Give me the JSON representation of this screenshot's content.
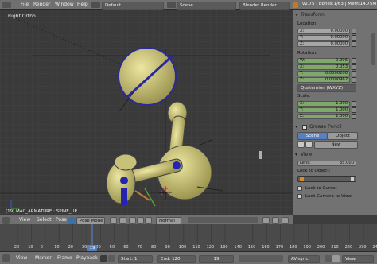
{
  "top_menu": {
    "file": "File",
    "render": "Render",
    "window": "Window",
    "help": "Help",
    "layout": "Default",
    "scene": "Scene",
    "engine": "Blender Render",
    "stats": "v2.75 | Bones:1/63 | Mem:14.75M"
  },
  "viewport": {
    "view_label": "Right Ortho",
    "status_label": "(19) MAC_ARMATURE : SPINE_UP"
  },
  "view3d_header": {
    "view": "View",
    "select": "Select",
    "pose": "Pose",
    "mode": "Pose Mode",
    "pivot": "Normal"
  },
  "npanel": {
    "transform": {
      "title": "Transform",
      "location_label": "Location:",
      "loc": [
        {
          "k": "X:",
          "v": "0.00000"
        },
        {
          "k": "Y:",
          "v": "0.00000"
        },
        {
          "k": "Z:",
          "v": "0.00000"
        }
      ],
      "rotation_label": "Rotation:",
      "rot": [
        {
          "k": "W:",
          "v": "0.996"
        },
        {
          "k": "X:",
          "v": "0.053"
        },
        {
          "k": "Y:",
          "v": "0.0000208"
        },
        {
          "k": "Z:",
          "v": "0.0000962"
        }
      ],
      "rotation_mode": "Quaternion (WXYZ)",
      "scale_label": "Scale:",
      "scale": [
        {
          "k": "X:",
          "v": "1.000"
        },
        {
          "k": "Y:",
          "v": "1.000"
        },
        {
          "k": "Z:",
          "v": "1.000"
        }
      ]
    },
    "grease": {
      "title": "Grease Pencil",
      "scene_tab": "Scene",
      "object_tab": "Object",
      "new_button": "New"
    },
    "view": {
      "title": "View",
      "lens_k": "Lens:",
      "lens_v": "35.000",
      "lock_label": "Lock to Object:",
      "lock_cursor": "Lock to Cursor",
      "lock_camera": "Lock Camera to View"
    }
  },
  "timeline": {
    "ticks": [
      "-20",
      "-10",
      "0",
      "10",
      "20",
      "30",
      "40",
      "50",
      "60",
      "70",
      "80",
      "90",
      "100",
      "110",
      "120",
      "130",
      "140",
      "150",
      "160",
      "170",
      "180",
      "190",
      "200",
      "210",
      "220",
      "230",
      "240"
    ],
    "cursor_frame": "19"
  },
  "timeline_header": {
    "view": "View",
    "marker": "Marker",
    "frame": "Frame",
    "playback": "Playback",
    "start_k": "Start:",
    "start_v": "1",
    "end_k": "End:",
    "end_v": "120",
    "current": "19",
    "sync": "AV-sync",
    "view_btn": "View"
  }
}
